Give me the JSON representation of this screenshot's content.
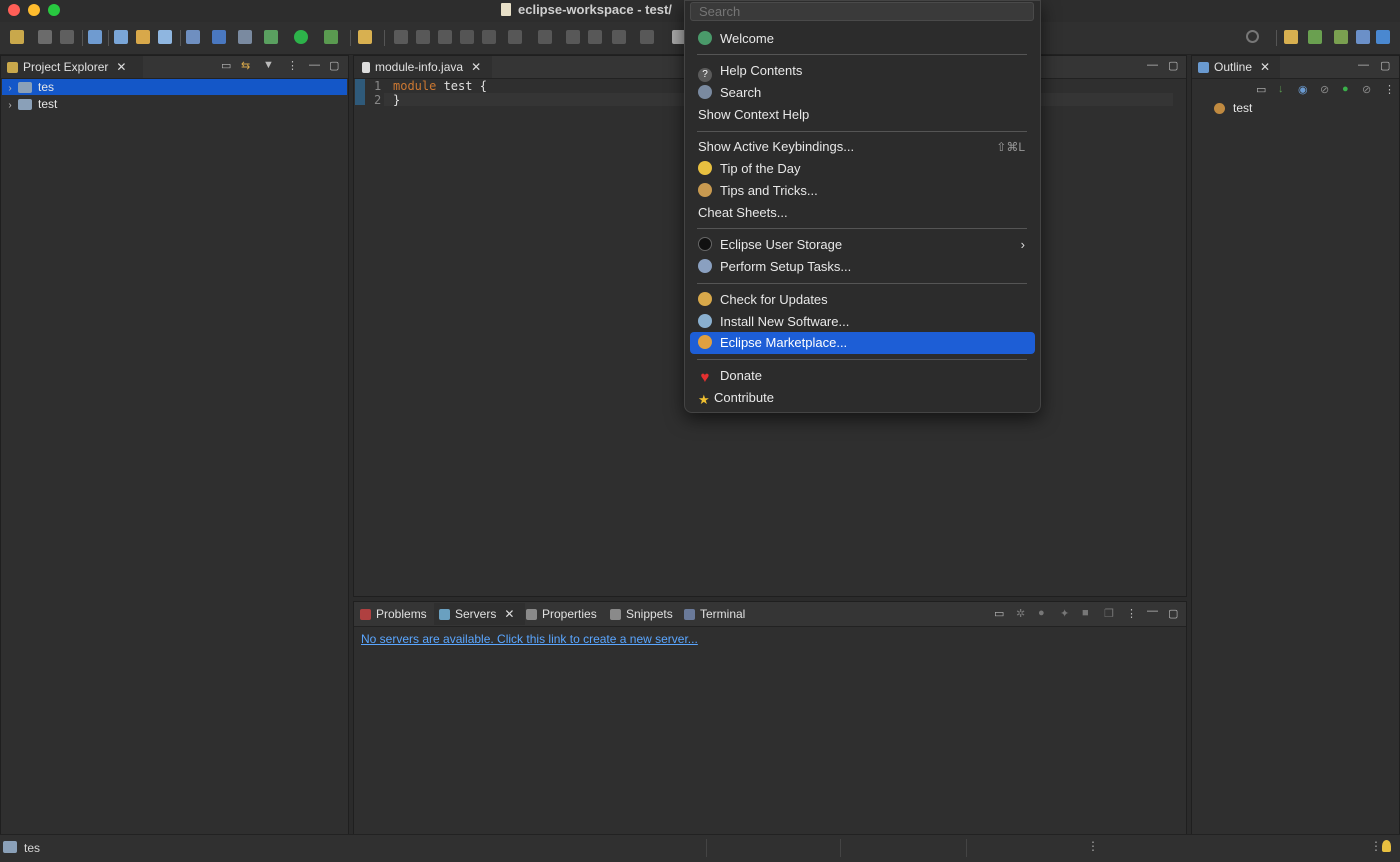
{
  "window": {
    "title": "eclipse-workspace - test/"
  },
  "project_explorer": {
    "tab_label": "Project Explorer",
    "items": [
      {
        "label": "tes",
        "selected": true
      },
      {
        "label": "test",
        "selected": false
      }
    ]
  },
  "editor": {
    "tab_label": "module-info.java",
    "lines": [
      {
        "num": "1",
        "keyword": "module",
        "rest": " test {"
      },
      {
        "num": "2",
        "keyword": "",
        "rest": "}"
      }
    ]
  },
  "outline": {
    "tab_label": "Outline",
    "items": [
      {
        "label": "test"
      }
    ]
  },
  "bottom_panel": {
    "tabs": [
      {
        "label": "Problems",
        "active": false
      },
      {
        "label": "Servers",
        "active": true
      },
      {
        "label": "Properties",
        "active": false
      },
      {
        "label": "Snippets",
        "active": false
      },
      {
        "label": "Terminal",
        "active": false
      }
    ],
    "servers_link": "No servers are available. Click this link to create a new server..."
  },
  "help_menu": {
    "search_placeholder": "Search",
    "items": {
      "welcome": "Welcome",
      "help_contents": "Help Contents",
      "search": "Search",
      "show_context_help": "Show Context Help",
      "show_active_keybindings": "Show Active Keybindings...",
      "keybindings_shortcut": "⇧⌘L",
      "tip_of_the_day": "Tip of the Day",
      "tips_and_tricks": "Tips and Tricks...",
      "cheat_sheets": "Cheat Sheets...",
      "eclipse_user_storage": "Eclipse User Storage",
      "perform_setup_tasks": "Perform Setup Tasks...",
      "check_for_updates": "Check for Updates",
      "install_new_software": "Install New Software...",
      "eclipse_marketplace": "Eclipse Marketplace...",
      "donate": "Donate",
      "contribute": "Contribute"
    },
    "highlighted": "eclipse_marketplace"
  },
  "status_bar": {
    "label": "tes"
  },
  "colors": {
    "selection": "#1457c8",
    "menu_highlight": "#1d5ed6",
    "keyword": "#cc7832",
    "link": "#5aa6ff"
  }
}
